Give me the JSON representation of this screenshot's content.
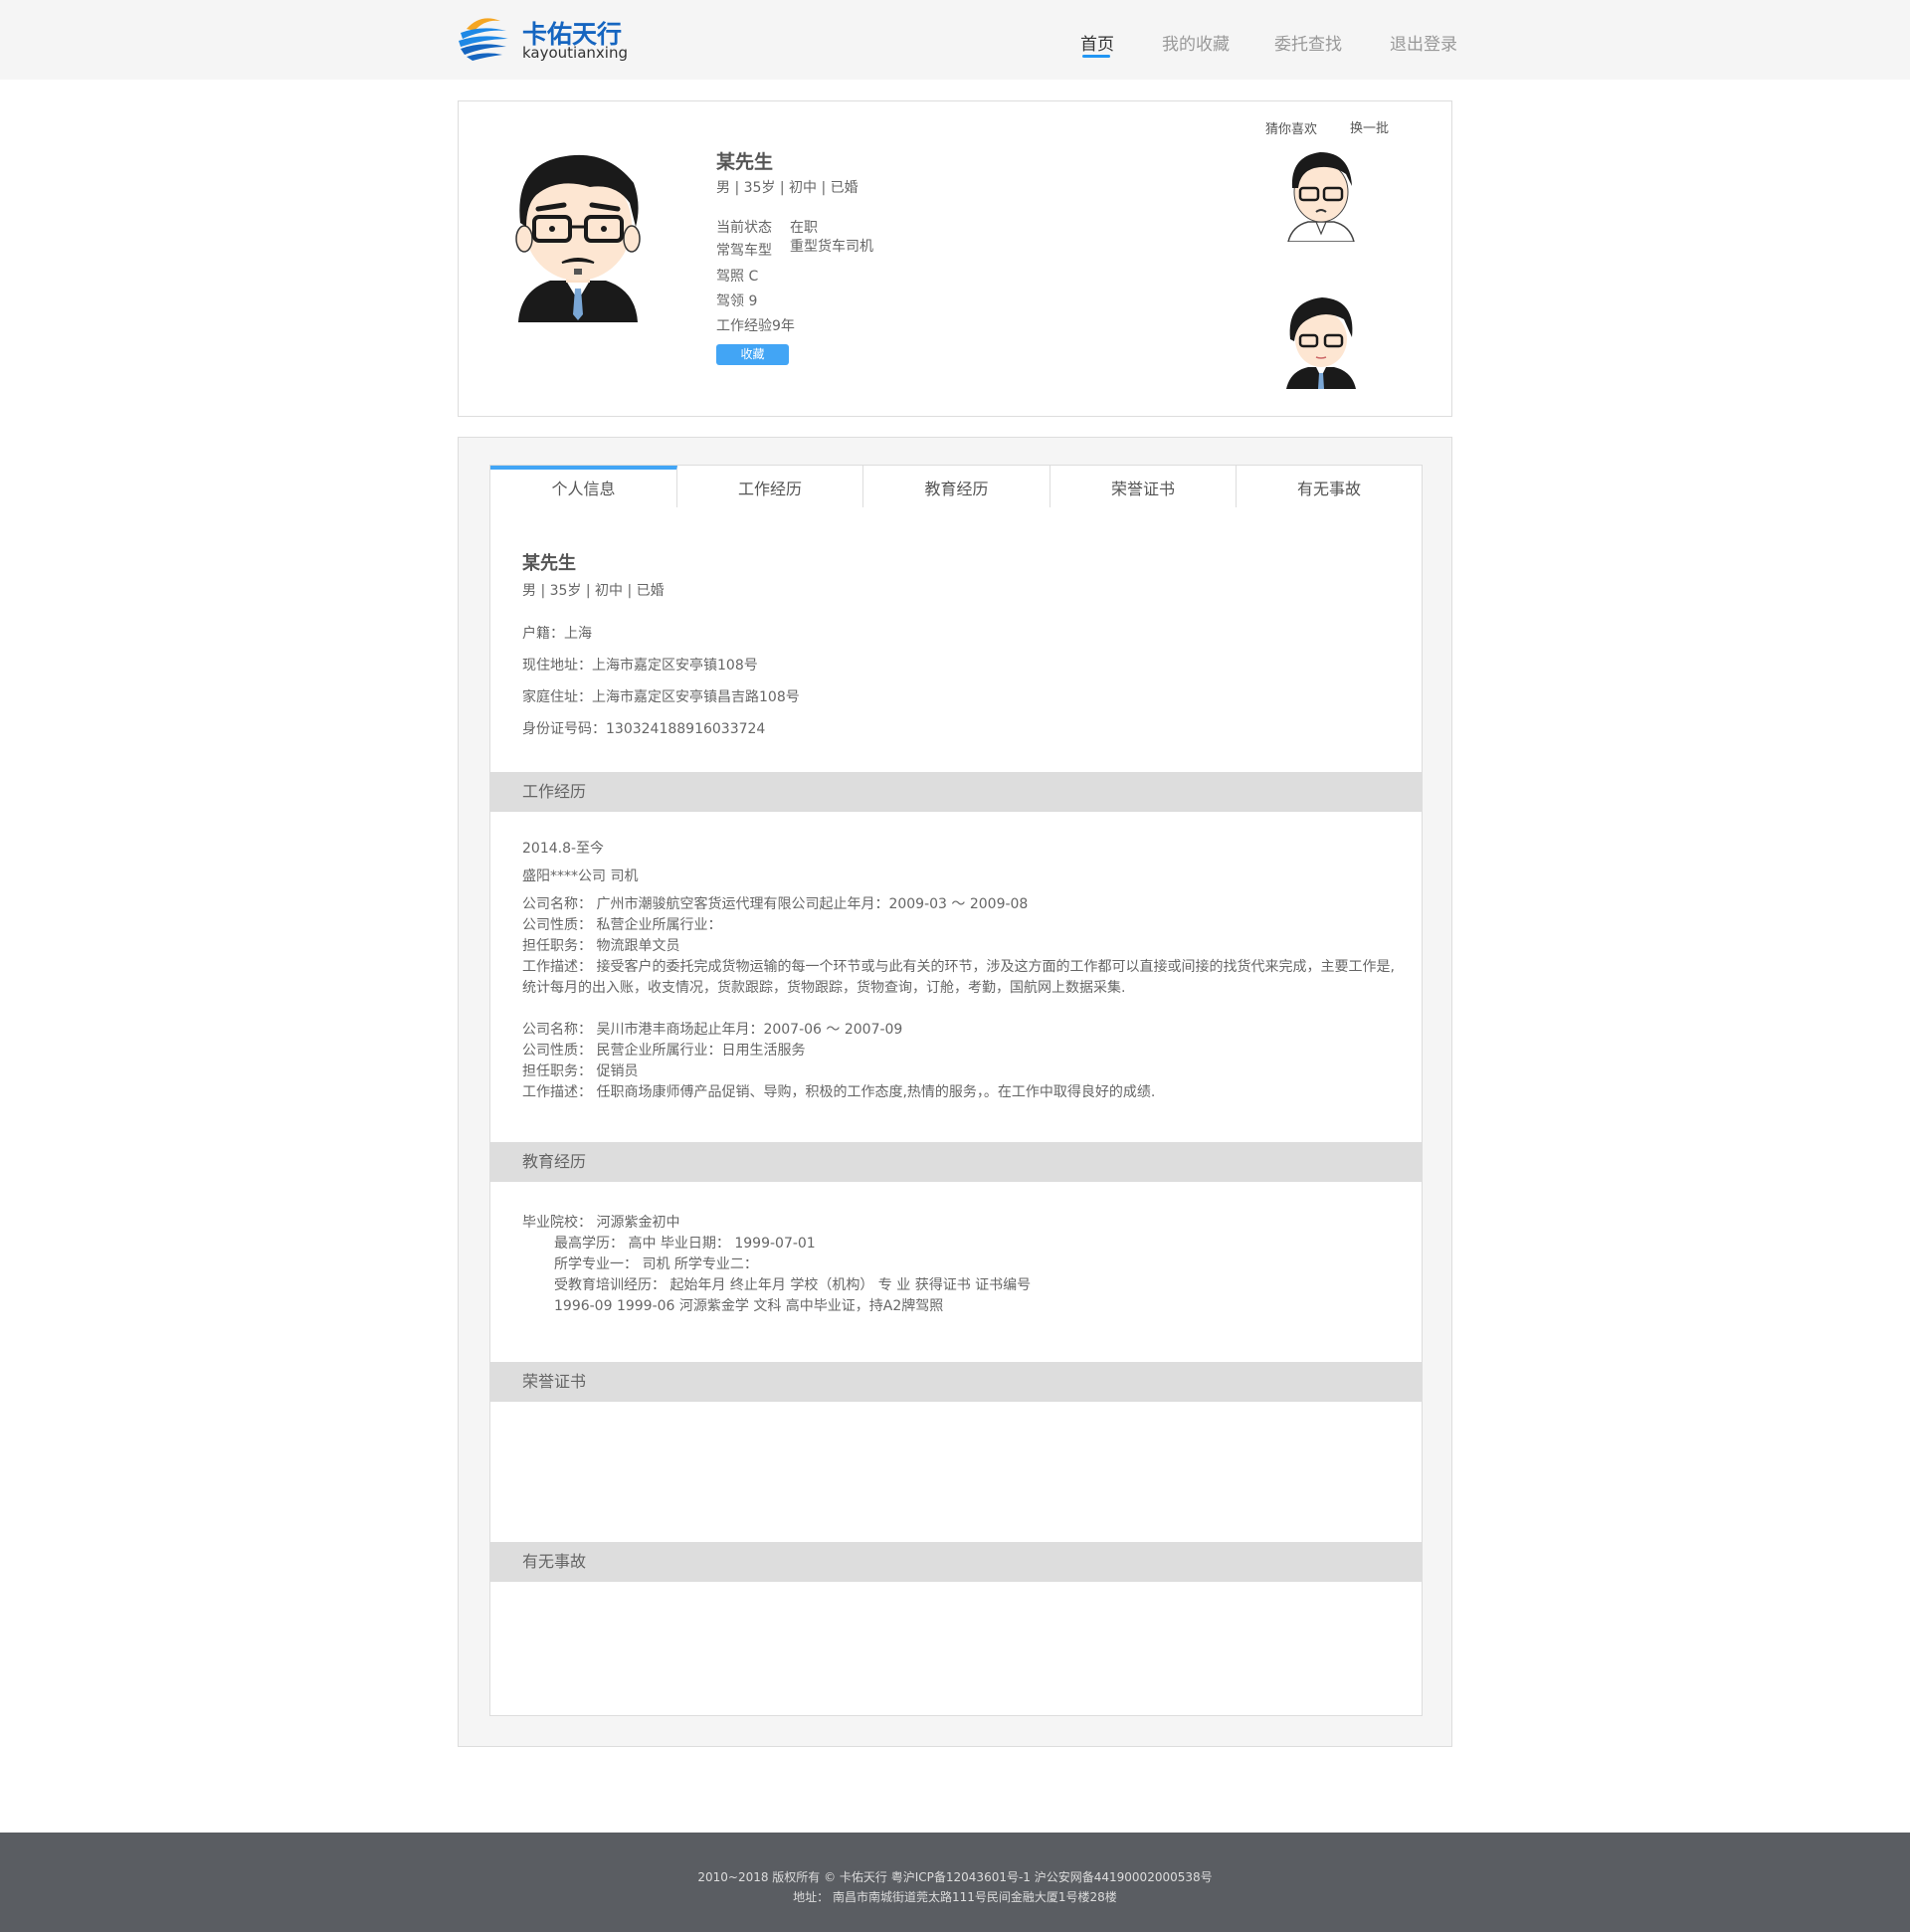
{
  "header": {
    "logo_cn": "卡佑天行",
    "logo_en": "kayoutianxing",
    "nav": [
      "首页",
      "我的收藏",
      "委托查找",
      "退出登录"
    ],
    "accent": "#2196f3"
  },
  "profile": {
    "name": "某先生",
    "summary": "男 | 35岁 | 初中 | 已婚",
    "status_label": "当前状态",
    "status_value": "在职",
    "vehicle_label": "常驾车型",
    "vehicle_value": "重型货车司机",
    "license": "驾照  C",
    "license_years": "驾领  9",
    "experience": "工作经验9年",
    "favorite_button": "收藏",
    "guess_label": "猜你喜欢",
    "refresh_label": "换一批"
  },
  "tabs": [
    "个人信息",
    "工作经历",
    "教育经历",
    "荣誉证书",
    "有无事故"
  ],
  "personal": {
    "name": "某先生",
    "summary": "男 | 35岁 | 初中 | 已婚",
    "hukou": "户籍：上海",
    "address": "现住地址：上海市嘉定区安亭镇108号",
    "home": "家庭住址：上海市嘉定区安亭镇昌吉路108号",
    "id_number": "身份证号码：130324188916033724"
  },
  "work": {
    "title": "工作经历",
    "period": "2014.8-至今",
    "current": "盛阳****公司   司机",
    "lines": [
      "公司名称：  广州市潮骏航空客货运代理有限公司起止年月：2009-03 ～ 2009-08",
      "公司性质：  私营企业所属行业：",
      "担任职务：  物流跟单文员",
      "工作描述：  接受客户的委托完成货物运输的每一个环节或与此有关的环节，涉及这方面的工作都可以直接或间接的找货代来完成，主要工作是,",
      "统计每月的出入账，收支情况，货款跟踪，货物跟踪，货物查询，订舱，考勤，国航网上数据采集.",
      "公司名称：  吴川市港丰商场起止年月：2007-06 ～ 2007-09",
      "公司性质：  民营企业所属行业：日用生活服务",
      "担任职务：  促销员",
      "工作描述：  任职商场康师傅产品促销、导购，积极的工作态度,热情的服务，。在工作中取得良好的成绩."
    ]
  },
  "education": {
    "title": "教育经历",
    "lines": [
      "毕业院校：  河源紫金初中",
      "最高学历：  高中 毕业日期：  1999-07-01",
      "所学专业一：  司机 所学专业二：",
      "受教育培训经历：  起始年月 终止年月 学校（机构） 专    业 获得证书 证书编号",
      "1996-09 1999-06 河源紫金学 文科 高中毕业证，持A2牌驾照"
    ]
  },
  "honors": {
    "title": "荣誉证书"
  },
  "accidents": {
    "title": "有无事故"
  },
  "footer": {
    "copyright": "2010~2018 版权所有 © 卡佑天行 粤沪ICP备12043601号-1 沪公安网备44190002000538号",
    "address": "地址：  南昌市南城街道莞太路111号民间金融大厦1号楼28楼"
  }
}
